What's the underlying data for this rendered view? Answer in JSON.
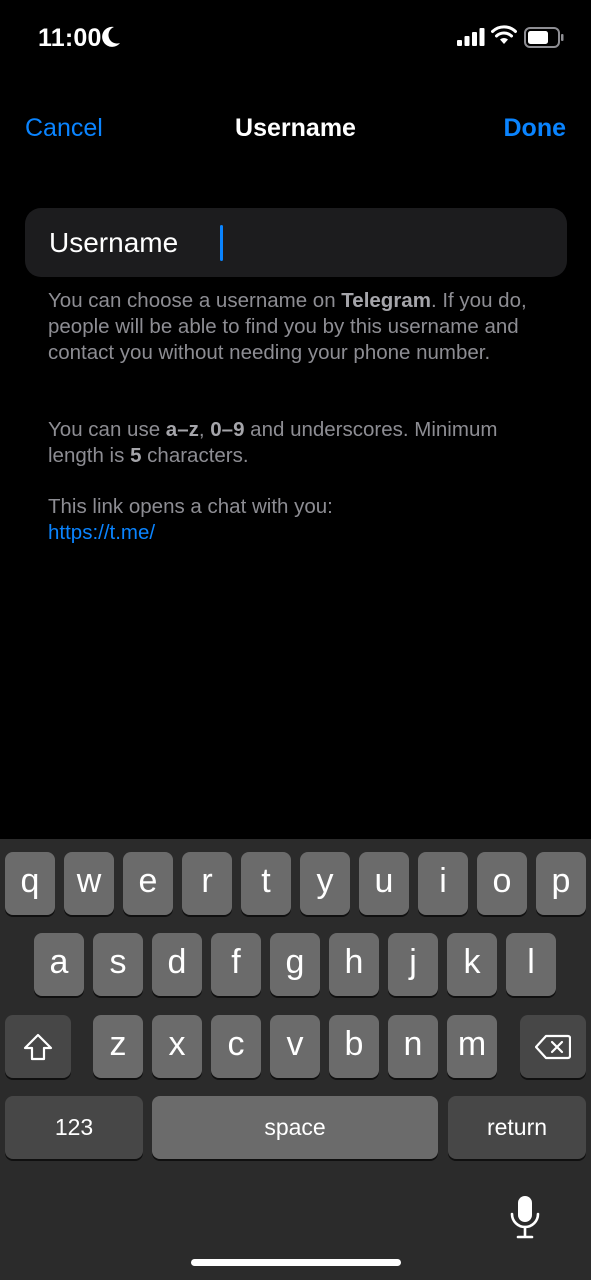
{
  "status_bar": {
    "time": "11:00",
    "icons": [
      "moon-icon",
      "cellular-signal-icon",
      "wifi-icon",
      "battery-icon"
    ]
  },
  "nav": {
    "cancel_label": "Cancel",
    "title": "Username",
    "done_label": "Done"
  },
  "field": {
    "label": "Username",
    "value": ""
  },
  "help": {
    "p1_a": "You can choose a username on ",
    "p1_bold": "Telegram",
    "p1_b": ". If you do, people will be able to find you by this username and contact you without needing your phone number.",
    "p2_a": "You can use ",
    "p2_bold1": "a–z",
    "p2_sep": ", ",
    "p2_bold2": "0–9",
    "p2_b": " and underscores. Minimum length is ",
    "p2_bold3": "5",
    "p2_c": " characters.",
    "p3_text": "This link opens a chat with you:",
    "p3_link": "https://t.me/"
  },
  "keyboard": {
    "row1": [
      "q",
      "w",
      "e",
      "r",
      "t",
      "y",
      "u",
      "i",
      "o",
      "p"
    ],
    "row2": [
      "a",
      "s",
      "d",
      "f",
      "g",
      "h",
      "j",
      "k",
      "l"
    ],
    "row3": [
      "z",
      "x",
      "c",
      "v",
      "b",
      "n",
      "m"
    ],
    "numbers_label": "123",
    "space_label": "space",
    "return_label": "return",
    "icons": [
      "shift-icon",
      "delete-icon",
      "microphone-icon"
    ]
  },
  "colors": {
    "accent": "#0a84ff",
    "background": "#000000",
    "field": "#1c1c1e",
    "key": "#6b6b6b",
    "key_dark": "#474747",
    "keyboard_bg": "#2b2b2b"
  }
}
